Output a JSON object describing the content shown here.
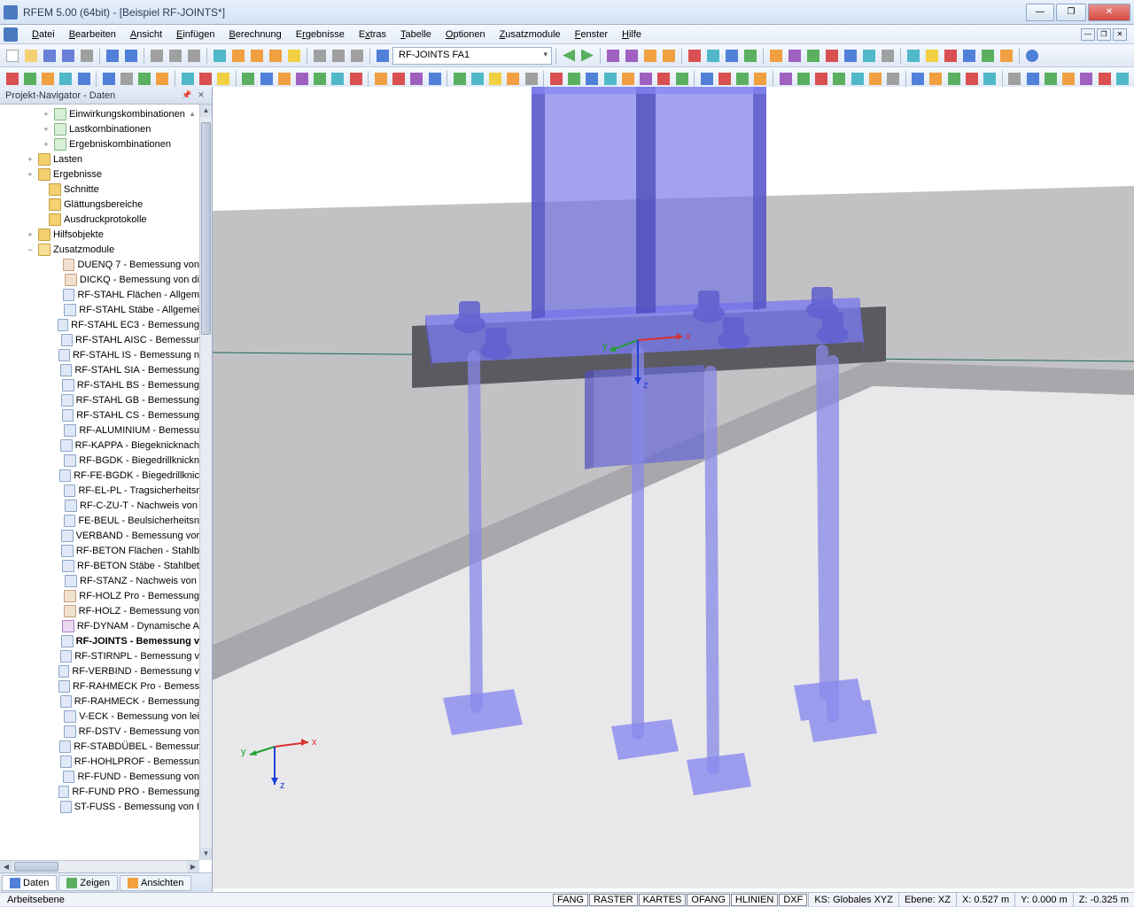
{
  "title": "RFEM 5.00 (64bit) - [Beispiel RF-JOINTS*]",
  "menu": [
    "Datei",
    "Bearbeiten",
    "Ansicht",
    "Einfügen",
    "Berechnung",
    "Ergebnisse",
    "Extras",
    "Tabelle",
    "Optionen",
    "Zusatzmodule",
    "Fenster",
    "Hilfe"
  ],
  "toolbar_dropdown": "RF-JOINTS FA1",
  "navigator": {
    "title": "Projekt-Navigator - Daten",
    "tabs": [
      "Daten",
      "Zeigen",
      "Ansichten"
    ],
    "items": [
      {
        "indent": 42,
        "exp": "+",
        "icon": "ni-mod2",
        "label": "Einwirkungskombinationen",
        "arrow": "▲"
      },
      {
        "indent": 42,
        "exp": "+",
        "icon": "ni-mod2",
        "label": "Lastkombinationen"
      },
      {
        "indent": 42,
        "exp": "+",
        "icon": "ni-mod2",
        "label": "Ergebniskombinationen"
      },
      {
        "indent": 24,
        "exp": "+",
        "icon": "ni-folder",
        "label": "Lasten"
      },
      {
        "indent": 24,
        "exp": "+",
        "icon": "ni-folder",
        "label": "Ergebnisse"
      },
      {
        "indent": 36,
        "exp": "",
        "icon": "ni-folder",
        "label": "Schnitte"
      },
      {
        "indent": 36,
        "exp": "",
        "icon": "ni-folder",
        "label": "Glättungsbereiche"
      },
      {
        "indent": 36,
        "exp": "",
        "icon": "ni-folder",
        "label": "Ausdruckprotokolle"
      },
      {
        "indent": 24,
        "exp": "+",
        "icon": "ni-folder",
        "label": "Hilfsobjekte"
      },
      {
        "indent": 24,
        "exp": "−",
        "icon": "ni-folder-open",
        "label": "Zusatzmodule"
      },
      {
        "indent": 54,
        "exp": "",
        "icon": "ni-mod3",
        "label": "DUENQ 7 - Bemessung von"
      },
      {
        "indent": 54,
        "exp": "",
        "icon": "ni-mod3",
        "label": "DICKQ - Bemessung von di"
      },
      {
        "indent": 54,
        "exp": "",
        "icon": "ni-mod",
        "label": "RF-STAHL Flächen - Allgem"
      },
      {
        "indent": 54,
        "exp": "",
        "icon": "ni-mod",
        "label": "RF-STAHL Stäbe - Allgemei"
      },
      {
        "indent": 54,
        "exp": "",
        "icon": "ni-mod",
        "label": "RF-STAHL EC3 - Bemessung"
      },
      {
        "indent": 54,
        "exp": "",
        "icon": "ni-mod",
        "label": "RF-STAHL AISC - Bemessur"
      },
      {
        "indent": 54,
        "exp": "",
        "icon": "ni-mod",
        "label": "RF-STAHL IS - Bemessung n"
      },
      {
        "indent": 54,
        "exp": "",
        "icon": "ni-mod",
        "label": "RF-STAHL SIA - Bemessung"
      },
      {
        "indent": 54,
        "exp": "",
        "icon": "ni-mod",
        "label": "RF-STAHL BS - Bemessung"
      },
      {
        "indent": 54,
        "exp": "",
        "icon": "ni-mod",
        "label": "RF-STAHL GB - Bemessung"
      },
      {
        "indent": 54,
        "exp": "",
        "icon": "ni-mod",
        "label": "RF-STAHL CS - Bemessung"
      },
      {
        "indent": 54,
        "exp": "",
        "icon": "ni-mod",
        "label": "RF-ALUMINIUM - Bemessu"
      },
      {
        "indent": 54,
        "exp": "",
        "icon": "ni-mod",
        "label": "RF-KAPPA - Biegeknicknach"
      },
      {
        "indent": 54,
        "exp": "",
        "icon": "ni-mod",
        "label": "RF-BGDK - Biegedrillknickn"
      },
      {
        "indent": 54,
        "exp": "",
        "icon": "ni-mod",
        "label": "RF-FE-BGDK - Biegedrillknic"
      },
      {
        "indent": 54,
        "exp": "",
        "icon": "ni-mod",
        "label": "RF-EL-PL - Tragsicherheitsr"
      },
      {
        "indent": 54,
        "exp": "",
        "icon": "ni-mod",
        "label": "RF-C-ZU-T - Nachweis von"
      },
      {
        "indent": 54,
        "exp": "",
        "icon": "ni-mod",
        "label": "FE-BEUL - Beulsicherheitsn"
      },
      {
        "indent": 54,
        "exp": "",
        "icon": "ni-mod",
        "label": "VERBAND - Bemessung vor"
      },
      {
        "indent": 54,
        "exp": "",
        "icon": "ni-mod",
        "label": "RF-BETON Flächen - Stahlb"
      },
      {
        "indent": 54,
        "exp": "",
        "icon": "ni-mod",
        "label": "RF-BETON Stäbe - Stahlbet"
      },
      {
        "indent": 54,
        "exp": "",
        "icon": "ni-mod",
        "label": "RF-STANZ - Nachweis von"
      },
      {
        "indent": 54,
        "exp": "",
        "icon": "ni-mod3",
        "label": "RF-HOLZ Pro - Bemessung"
      },
      {
        "indent": 54,
        "exp": "",
        "icon": "ni-mod3",
        "label": "RF-HOLZ - Bemessung von"
      },
      {
        "indent": 54,
        "exp": "",
        "icon": "ni-mod4",
        "label": "RF-DYNAM - Dynamische A"
      },
      {
        "indent": 54,
        "exp": "",
        "icon": "ni-mod",
        "label": "RF-JOINTS - Bemessung v",
        "selected": true
      },
      {
        "indent": 54,
        "exp": "",
        "icon": "ni-mod",
        "label": "RF-STIRNPL - Bemessung v"
      },
      {
        "indent": 54,
        "exp": "",
        "icon": "ni-mod",
        "label": "RF-VERBIND - Bemessung v"
      },
      {
        "indent": 54,
        "exp": "",
        "icon": "ni-mod",
        "label": "RF-RAHMECK Pro - Bemess"
      },
      {
        "indent": 54,
        "exp": "",
        "icon": "ni-mod",
        "label": "RF-RAHMECK - Bemessung"
      },
      {
        "indent": 54,
        "exp": "",
        "icon": "ni-mod",
        "label": "V-ECK - Bemessung von lei"
      },
      {
        "indent": 54,
        "exp": "",
        "icon": "ni-mod",
        "label": "RF-DSTV - Bemessung von"
      },
      {
        "indent": 54,
        "exp": "",
        "icon": "ni-mod",
        "label": "RF-STABDÜBEL - Bemessur"
      },
      {
        "indent": 54,
        "exp": "",
        "icon": "ni-mod",
        "label": "RF-HOHLPROF - Bemessun"
      },
      {
        "indent": 54,
        "exp": "",
        "icon": "ni-mod",
        "label": "RF-FUND - Bemessung von"
      },
      {
        "indent": 54,
        "exp": "",
        "icon": "ni-mod",
        "label": "RF-FUND PRO - Bemessung"
      },
      {
        "indent": 54,
        "exp": "",
        "icon": "ni-mod",
        "label": "ST-FUSS - Bemessung von I"
      }
    ]
  },
  "status": {
    "left": "Arbeitsebene",
    "badges": [
      "FANG",
      "RASTER",
      "KARTES",
      "OFANG",
      "HLINIEN",
      "DXF"
    ],
    "ks": "KS: Globales XYZ",
    "ebene": "Ebene: XZ",
    "x": "X: 0.527 m",
    "y": "Y: 0.000 m",
    "z": "Z: -0.325 m"
  },
  "axes": {
    "x": "x",
    "y": "y",
    "z": "z"
  }
}
